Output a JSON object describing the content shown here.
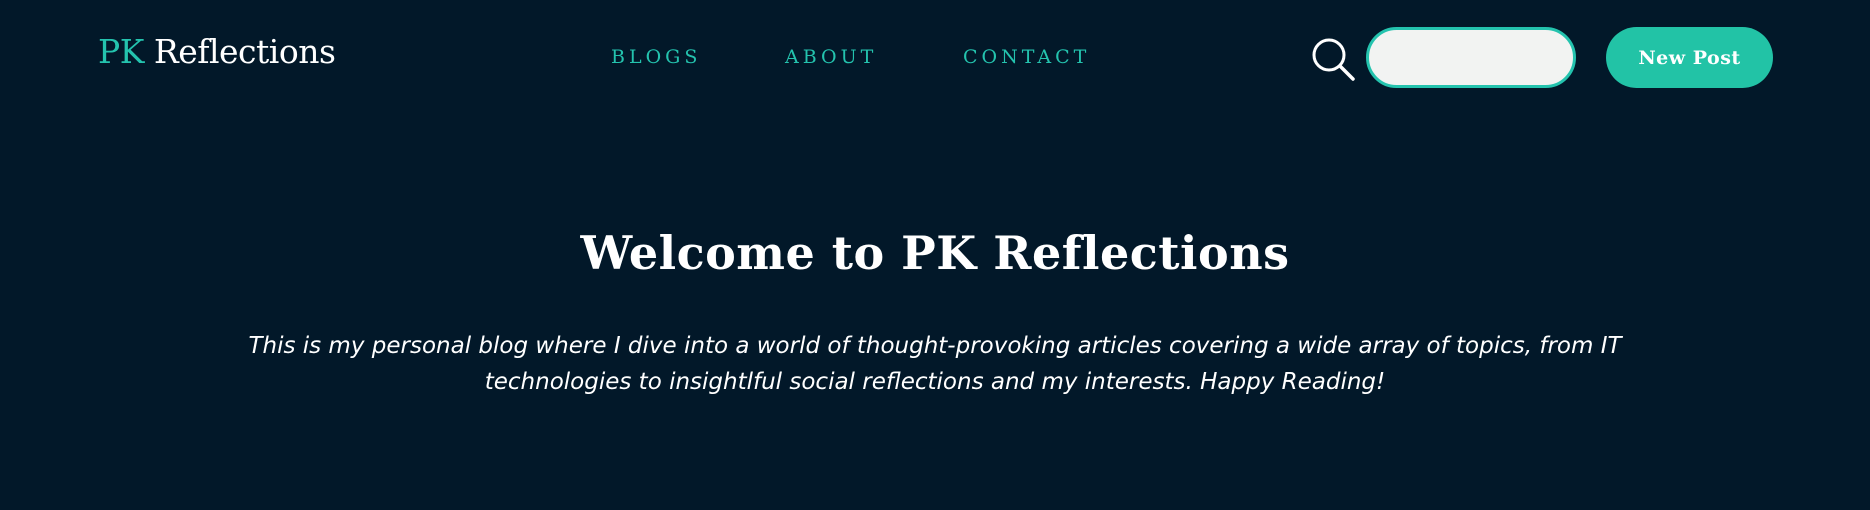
{
  "header": {
    "logo": {
      "accent": "PK",
      "rest": "Reflections"
    },
    "nav": [
      {
        "label": "BLOGS"
      },
      {
        "label": "ABOUT"
      },
      {
        "label": "CONTACT"
      }
    ],
    "search": {
      "icon": "search-icon",
      "value": "",
      "placeholder": ""
    },
    "new_post_label": "New Post"
  },
  "hero": {
    "title": "Welcome to PK Reflections",
    "description": "This is my personal blog where I dive into a world of thought-provoking articles covering a wide array of topics, from IT technologies to insightlful social reflections and my interests. Happy Reading!"
  },
  "colors": {
    "background": "#021829",
    "accent": "#24c3ae",
    "button": "#22c3a6",
    "search_field": "#f2f3f2",
    "text": "#ffffff"
  }
}
